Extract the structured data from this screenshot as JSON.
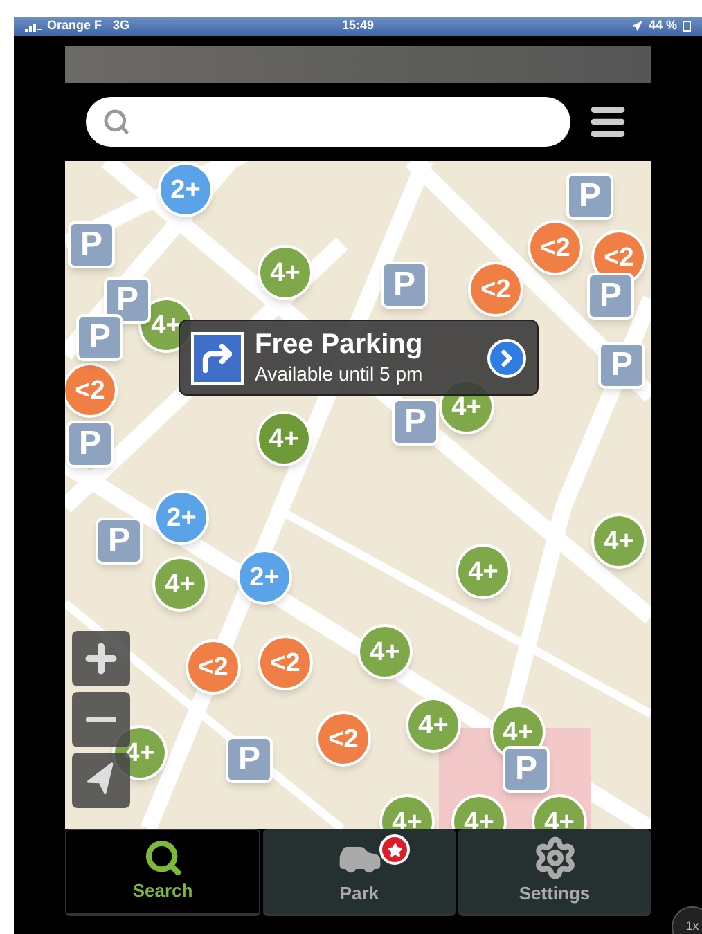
{
  "status_bar": {
    "carrier": "Orange F",
    "network": "3G",
    "time": "15:49",
    "battery": "44 %"
  },
  "markers": [
    {
      "kind": "count",
      "label": "2+",
      "color": "#5aa3e8"
    },
    {
      "kind": "count",
      "label": "4+",
      "color": "#7fa84a"
    },
    {
      "kind": "count",
      "label": "4+",
      "color": "#7fa84a"
    },
    {
      "kind": "count",
      "label": "<2",
      "color": "#f07f45"
    },
    {
      "kind": "count",
      "label": "<2",
      "color": "#f07f45"
    },
    {
      "kind": "count",
      "label": "<2",
      "color": "#f07f45"
    },
    {
      "kind": "count",
      "label": "<2",
      "color": "#f07f45"
    },
    {
      "kind": "parking",
      "label": "P"
    },
    {
      "kind": "parking",
      "label": "P"
    },
    {
      "kind": "parking",
      "label": "P"
    },
    {
      "kind": "parking",
      "label": "P"
    },
    {
      "kind": "parking",
      "label": "P"
    },
    {
      "kind": "parking",
      "label": "P"
    },
    {
      "kind": "parking",
      "label": "P"
    },
    {
      "kind": "parking",
      "label": "P"
    },
    {
      "kind": "count",
      "label": "4+",
      "color": "#7fa84a"
    },
    {
      "kind": "parking",
      "label": "P"
    },
    {
      "kind": "count",
      "label": "4+",
      "color": "#6f9a3a"
    },
    {
      "kind": "count",
      "label": "2+",
      "color": "#5aa3e8"
    },
    {
      "kind": "count",
      "label": "2+",
      "color": "#5aa3e8"
    },
    {
      "kind": "parking",
      "label": "P"
    },
    {
      "kind": "count",
      "label": "4+",
      "color": "#7fa84a"
    },
    {
      "kind": "count",
      "label": "4+",
      "color": "#7fa84a"
    },
    {
      "kind": "count",
      "label": "4+",
      "color": "#7fa84a"
    },
    {
      "kind": "count",
      "label": "<2",
      "color": "#f07f45"
    },
    {
      "kind": "count",
      "label": "<2",
      "color": "#f07f45"
    },
    {
      "kind": "count",
      "label": "4+",
      "color": "#7fa84a"
    },
    {
      "kind": "count",
      "label": "<2",
      "color": "#f07f45"
    },
    {
      "kind": "count",
      "label": "4+",
      "color": "#7fa84a"
    },
    {
      "kind": "count",
      "label": "4+",
      "color": "#7fa84a"
    },
    {
      "kind": "count",
      "label": "4+",
      "color": "#7fa84a"
    },
    {
      "kind": "parking",
      "label": "P"
    },
    {
      "kind": "parking",
      "label": "P"
    },
    {
      "kind": "count",
      "label": "4+",
      "color": "#7fa84a"
    },
    {
      "kind": "count",
      "label": "4+",
      "color": "#7fa84a"
    },
    {
      "kind": "count",
      "label": "4+",
      "color": "#7fa84a"
    }
  ],
  "callout": {
    "title": "Free Parking",
    "subtitle": "Available until 5 pm"
  },
  "tabs": [
    {
      "label": "Search",
      "selected": true
    },
    {
      "label": "Park",
      "selected": false,
      "badge": true
    },
    {
      "label": "Settings",
      "selected": false
    }
  ],
  "zoom_badge": "1x"
}
